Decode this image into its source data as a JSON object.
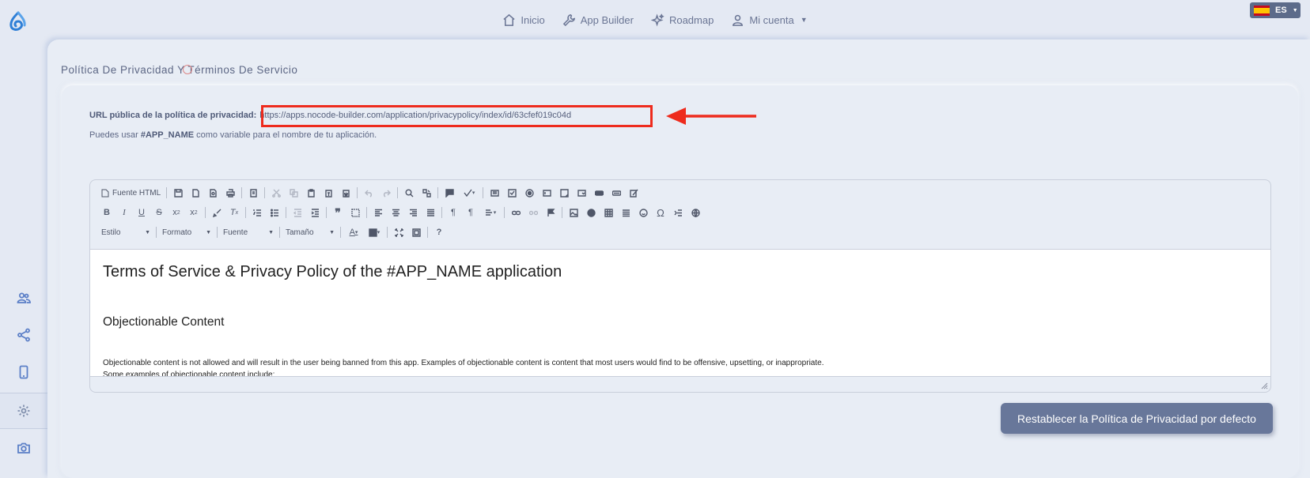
{
  "nav": {
    "items": [
      {
        "label": "Inicio",
        "icon": "home-icon"
      },
      {
        "label": "App Builder",
        "icon": "wrench-icon"
      },
      {
        "label": "Roadmap",
        "icon": "sparkle-icon"
      },
      {
        "label": "Mi cuenta",
        "icon": "user-icon"
      }
    ],
    "lang": "ES"
  },
  "sidebar": {
    "items": [
      {
        "icon": "users-icon"
      },
      {
        "icon": "share-icon"
      },
      {
        "icon": "phone-icon"
      },
      {
        "icon": "gear-icon",
        "active": true
      },
      {
        "icon": "camera-icon"
      }
    ]
  },
  "page": {
    "title": "Política De Privacidad Y Términos De Servicio",
    "url_label": "URL pública de la política de privacidad:",
    "url_value": "https://apps.nocode-builder.com/application/privacypolicy/index/id/63cfef019c04d",
    "hint_prefix": "Puedes usar",
    "hint_variable": "#APP_NAME",
    "hint_suffix": "como variable para el nombre de tu aplicación."
  },
  "editor": {
    "source_label": "Fuente HTML",
    "combos": [
      "Estilo",
      "Formato",
      "Fuente",
      "Tamaño"
    ],
    "content": {
      "heading": "Terms of Service & Privacy Policy of the #APP_NAME application",
      "subheading": "Objectionable Content",
      "paragraph_1": "Objectionable content is not allowed and will result in the user being banned from this app. Examples of objectionable content is content that most users would find to be offensive, upsetting, or inappropriate.",
      "paragraph_2": "Some examples of objectionable content include:"
    }
  },
  "actions": {
    "reset_label": "Restablecer la Política de Privacidad por defecto"
  },
  "colors": {
    "background": "#e4e9f3",
    "accent_icon": "#5b7fc7",
    "button": "#68779a",
    "highlight": "#ee2b1d"
  }
}
